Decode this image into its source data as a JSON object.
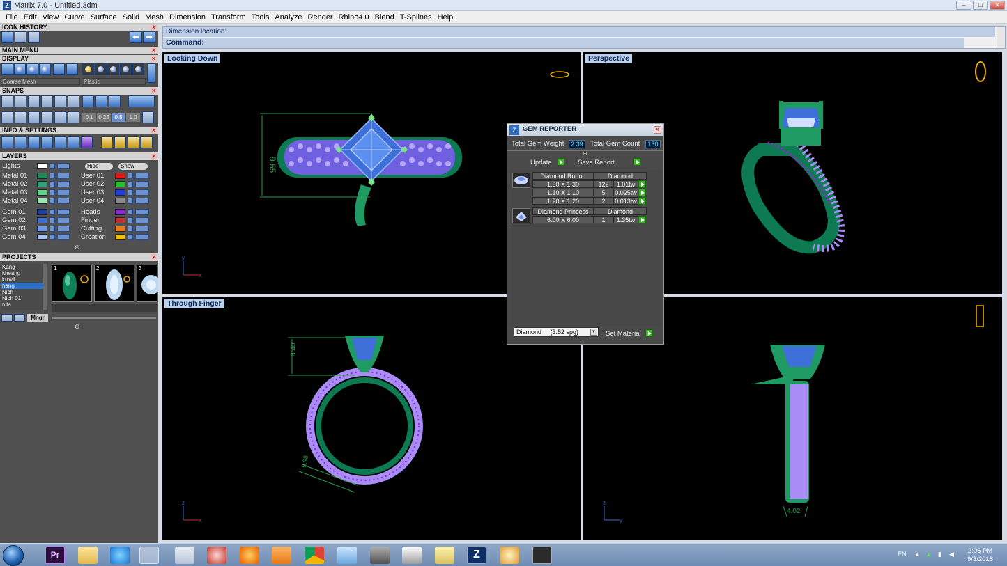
{
  "window": {
    "title": "Matrix 7.0 - Untitled.3dm",
    "controls": [
      "–",
      "□",
      "✕"
    ]
  },
  "menu": [
    "File",
    "Edit",
    "View",
    "Curve",
    "Surface",
    "Solid",
    "Mesh",
    "Dimension",
    "Transform",
    "Tools",
    "Analyze",
    "Render",
    "Rhino4.0",
    "Blend",
    "T-Splines",
    "Help"
  ],
  "left_panel": {
    "icon_history": "ICON HISTORY",
    "main_menu": "MAIN MENU",
    "display": "DISPLAY",
    "display_mesh": "Coarse Mesh",
    "display_material": "Plastic",
    "snaps": "SNAPS",
    "snap_values": [
      "0.1",
      "0.25",
      "0.5",
      "1.0"
    ],
    "info_settings": "INFO & SETTINGS",
    "layers": "LAYERS",
    "lights": "Lights",
    "hide": "Hide",
    "show": "Show",
    "layers_left": [
      "Metal 01",
      "Metal 02",
      "Metal 03",
      "Metal 04",
      "Gem 01",
      "Gem 02",
      "Gem 03",
      "Gem 04"
    ],
    "layers_right": [
      "User 01",
      "User 02",
      "User 03",
      "User 04",
      "Heads",
      "Finger",
      "Cutting",
      "Creation"
    ],
    "layer_colors_left": [
      "#1f8a5a",
      "#2aa57a",
      "#5fd48a",
      "#9ee7b4",
      "#1d3f9c",
      "#3b6ed0",
      "#6b9be8",
      "#a9c4f2"
    ],
    "layer_colors_right": [
      "#e01818",
      "#22c32a",
      "#1f3ee0",
      "#8a8a8a",
      "#8a2bd0",
      "#c03030",
      "#f07a10",
      "#f0c010"
    ],
    "projects": "PROJECTS",
    "project_list": [
      "Kang",
      "kheang",
      "krovil",
      "nang",
      "Nich",
      "Nich 01",
      "nita"
    ],
    "selected_project": "nang",
    "thumb_numbers": [
      "1",
      "2",
      "3"
    ],
    "manager": "Mngr"
  },
  "command": {
    "line1": "Dimension location:",
    "line2": "Command:"
  },
  "viewports": {
    "top_left": "Looking Down",
    "top_right": "Perspective",
    "bottom_left": "Through Finger",
    "bottom_right": "",
    "dims": {
      "top": "9.65",
      "front": "8.40",
      "band": "0.98",
      "side": "4.02"
    },
    "axes": {
      "x": "x",
      "y": "y",
      "z": "z"
    }
  },
  "gem_reporter": {
    "title": "GEM REPORTER",
    "total_weight_label": "Total Gem Weight",
    "total_weight": "2.39",
    "total_count_label": "Total Gem Count",
    "total_count": "130",
    "update": "Update",
    "save_report": "Save Report",
    "groups": [
      {
        "name": "Diamond Round",
        "material": "Diamond",
        "rows": [
          {
            "size": "1.30 X 1.30",
            "count": "122",
            "weight": "1.01tw"
          },
          {
            "size": "1.10 X 1.10",
            "count": "5",
            "weight": "0.025tw"
          },
          {
            "size": "1.20 X 1.20",
            "count": "2",
            "weight": "0.013tw"
          }
        ]
      },
      {
        "name": "Diamond Princess",
        "material": "Diamond",
        "rows": [
          {
            "size": "6.00 X 6.00",
            "count": "1",
            "weight": "1.35tw"
          }
        ]
      }
    ],
    "material_select": "Diamond     (3.52 spg)",
    "set_material": "Set Material"
  },
  "taskbar": {
    "lang": "EN",
    "time": "2:06 PM",
    "date": "9/3/2018"
  },
  "colors": {
    "metal": "#1f8a5a",
    "gem": "#5b8ff0",
    "pave": "#a98cf5",
    "prong_pave": "#8a2bd0",
    "dimension": "#2ba04a",
    "wire": "#f0b400"
  }
}
